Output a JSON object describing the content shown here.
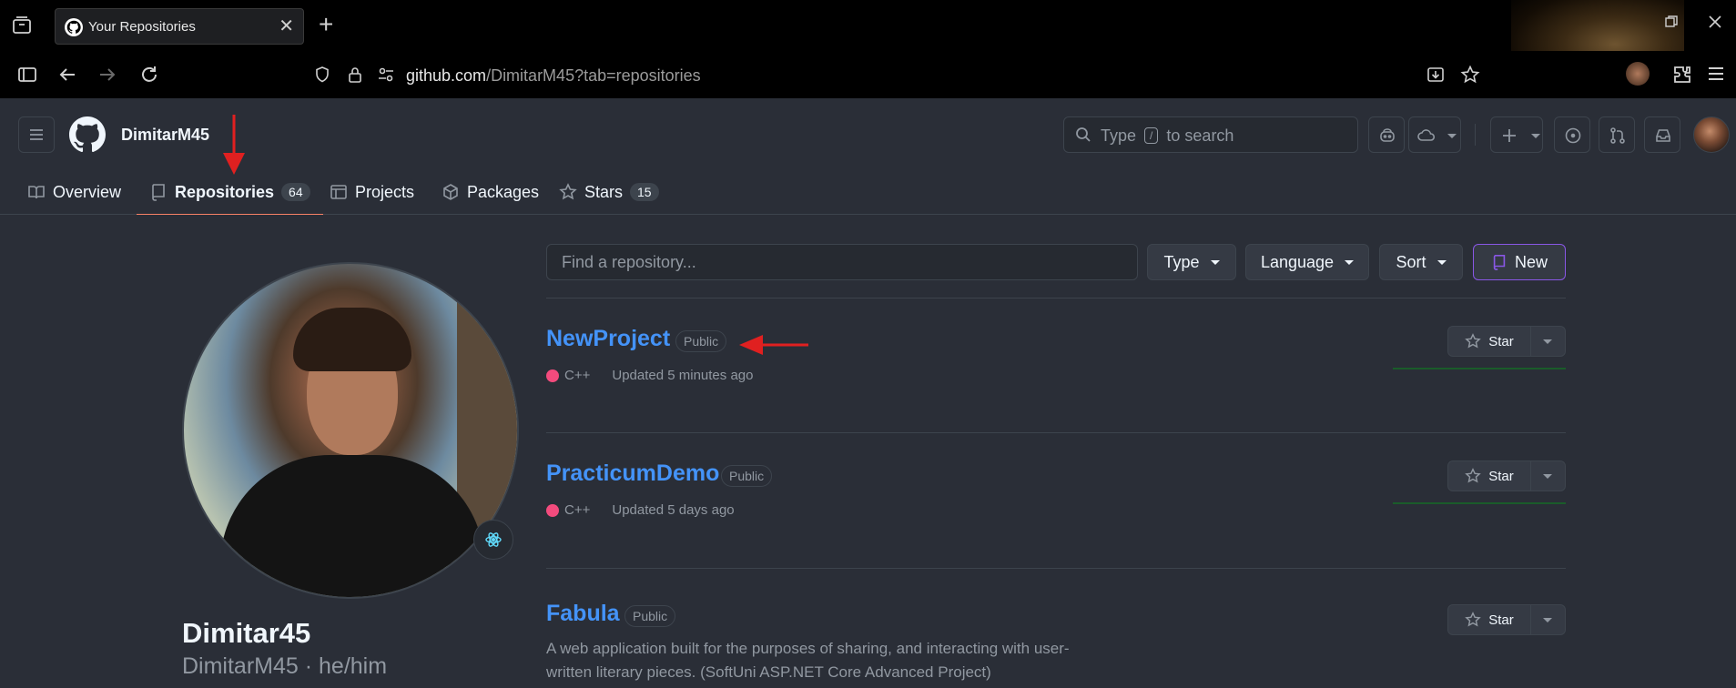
{
  "browser": {
    "tab_title": "Your Repositories",
    "url_host": "github.com",
    "url_path": "/DimitarM45?tab=repositories"
  },
  "header": {
    "username": "DimitarM45",
    "search_before": "Type",
    "search_key": "/",
    "search_after": "to search"
  },
  "profile_tabs": [
    {
      "label": "Overview",
      "count": null
    },
    {
      "label": "Repositories",
      "count": "64"
    },
    {
      "label": "Projects",
      "count": null
    },
    {
      "label": "Packages",
      "count": null
    },
    {
      "label": "Stars",
      "count": "15"
    }
  ],
  "profile": {
    "name": "Dimitar45",
    "login_line": "DimitarM45 · he/him"
  },
  "filters": {
    "search_placeholder": "Find a repository...",
    "type": "Type",
    "language": "Language",
    "sort": "Sort",
    "new": "New"
  },
  "repos": [
    {
      "name": "NewProject",
      "visibility": "Public",
      "language": "C++",
      "updated": "Updated 5 minutes ago",
      "description": ""
    },
    {
      "name": "PracticumDemo",
      "visibility": "Public",
      "language": "C++",
      "updated": "Updated 5 days ago",
      "description": ""
    },
    {
      "name": "Fabula",
      "visibility": "Public",
      "language": "",
      "updated": "",
      "description": "A web application built for the purposes of sharing, and interacting with user-written literary pieces. (SoftUni ASP.NET Core Advanced Project)"
    }
  ],
  "star_label": "Star",
  "colors": {
    "accent_link": "#4493f8",
    "cpp": "#f34b7d",
    "annotation_arrow": "#e02020",
    "tab_underline": "#f78166"
  }
}
